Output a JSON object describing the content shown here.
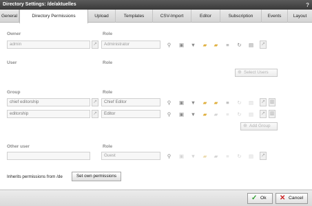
{
  "window": {
    "title": "Directory Settings: /de/aktuelles",
    "help_icon": "?"
  },
  "tabs": [
    {
      "label": "General"
    },
    {
      "label": "Directory Permissions"
    },
    {
      "label": "Upload"
    },
    {
      "label": "Templates"
    },
    {
      "label": "CSV-Import"
    },
    {
      "label": "Editor"
    },
    {
      "label": "Subscription"
    },
    {
      "label": "Events"
    },
    {
      "label": "Layout"
    }
  ],
  "active_tab": "Directory Permissions",
  "columns": {
    "role": "Role"
  },
  "owner": {
    "label": "Owner",
    "name": "admin",
    "role": "Administrator"
  },
  "user": {
    "label": "User",
    "select_button": "Select Users"
  },
  "group": {
    "label": "Group",
    "rows": [
      {
        "name": "chief editorship",
        "role": "Chief Editor"
      },
      {
        "name": "editorship",
        "role": "Editor"
      }
    ],
    "add_button": "Add Group"
  },
  "other_user": {
    "label": "Other user",
    "name": "",
    "role": "Guest"
  },
  "inherit": {
    "text": "Inherits permissions from /de",
    "button": "Set own permissions"
  },
  "footer": {
    "ok": "Ok",
    "cancel": "Cancel"
  },
  "colors": {
    "ok_check": "#2e9e2e",
    "cancel_x": "#cc2222",
    "folder": "#e0b040"
  }
}
